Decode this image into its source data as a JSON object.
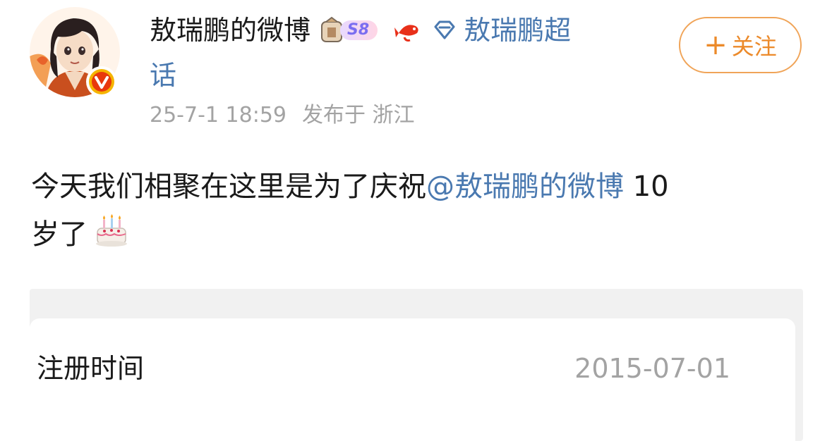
{
  "header": {
    "username": "敖瑞鹏的微博",
    "level": "S8",
    "supertopic_line1": "敖瑞鹏超",
    "supertopic_line2": "话",
    "timestamp": "25-7-1 18:59",
    "location": "发布于 浙江",
    "follow_label": "关注",
    "follow_plus": "+"
  },
  "post": {
    "text_before": "今天我们相聚在这里是为了庆祝",
    "mention": "@敖瑞鹏的微博",
    "text_after": " 10",
    "text_line2": "岁了"
  },
  "card": {
    "label": "注册时间",
    "value": "2015-07-01"
  },
  "colors": {
    "link": "#4a79b0",
    "follow_orange": "#ec8a2a",
    "meta_gray": "#a3a3a3",
    "verified": "#f5b400"
  },
  "icons": {
    "verified": "verified-v-icon",
    "level": "level-badge-icon",
    "fish": "koi-fish-icon",
    "supertopic": "diamond-icon",
    "cake": "birthday-cake-icon"
  }
}
